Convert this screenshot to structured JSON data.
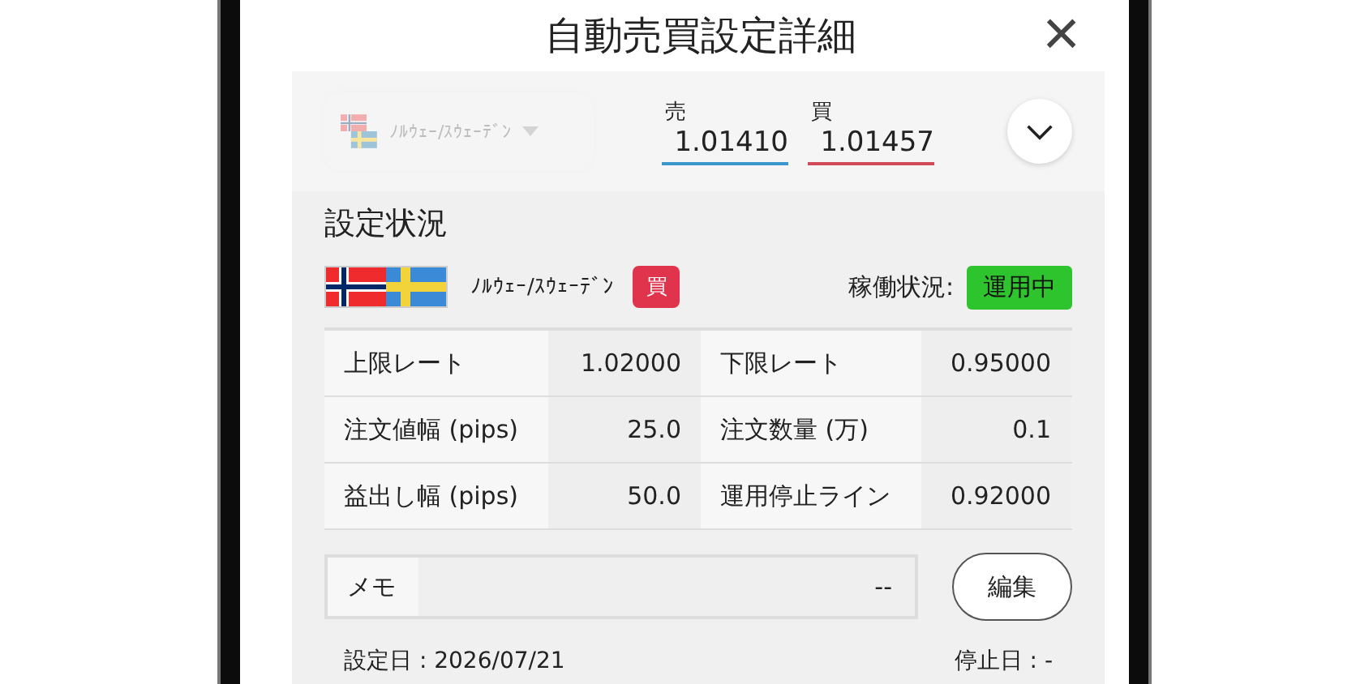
{
  "header": {
    "title": "自動売買設定詳細",
    "close": "×"
  },
  "quote": {
    "pair_selector": {
      "label": "ﾉﾙｳｪｰ/ｽｳｪｰﾃﾞﾝ",
      "disabled": true
    },
    "sell": {
      "label": "売",
      "value": "1.01410"
    },
    "buy": {
      "label": "買",
      "value": "1.01457"
    }
  },
  "settings": {
    "title": "設定状況",
    "pair": "ﾉﾙｳｪｰ/ｽｳｪｰﾃﾞﾝ",
    "side": "買",
    "status_label": "稼働状況:",
    "status": "運用中",
    "rows": [
      {
        "label_1": "上限レート",
        "value_1": "1.02000",
        "label_2": "下限レート",
        "value_2": "0.95000"
      },
      {
        "label_1": "注文値幅 (pips)",
        "value_1": "25.0",
        "label_2": "注文数量 (万)",
        "value_2": "0.1"
      },
      {
        "label_1": "益出し幅 (pips)",
        "value_1": "50.0",
        "label_2": "運用停止ライン",
        "value_2": "0.92000"
      }
    ],
    "memo": {
      "label": "メモ",
      "value": "--"
    },
    "edit_button": "編集",
    "set_date": "設定日 : 2026/07/21",
    "stop_date": "停止日 : -"
  }
}
